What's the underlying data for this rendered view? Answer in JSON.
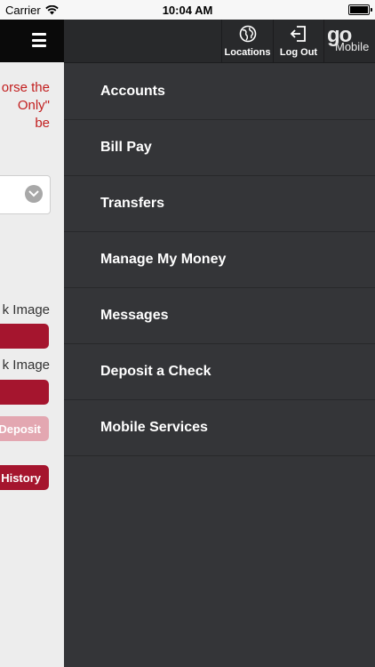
{
  "status_bar": {
    "carrier": "Carrier",
    "time": "10:04 AM",
    "battery_level": 1.0
  },
  "main": {
    "endorse_lines": [
      "orse the",
      "Only\"",
      "be"
    ],
    "front_label": "k Image",
    "back_label": "k Image",
    "deposit_button": "Deposit",
    "history_button": "History"
  },
  "header": {
    "locations_label": "Locations",
    "logout_label": "Log Out",
    "logo_go": "go",
    "logo_mobile": "Mobile"
  },
  "menu": {
    "items": [
      {
        "label": "Accounts"
      },
      {
        "label": "Bill Pay"
      },
      {
        "label": "Transfers"
      },
      {
        "label": "Manage My Money"
      },
      {
        "label": "Messages"
      },
      {
        "label": "Deposit a Check"
      },
      {
        "label": "Mobile Services"
      }
    ]
  },
  "colors": {
    "accent_red": "#a5152e",
    "drawer_bg": "#343538",
    "header_bg": "#28292b"
  }
}
